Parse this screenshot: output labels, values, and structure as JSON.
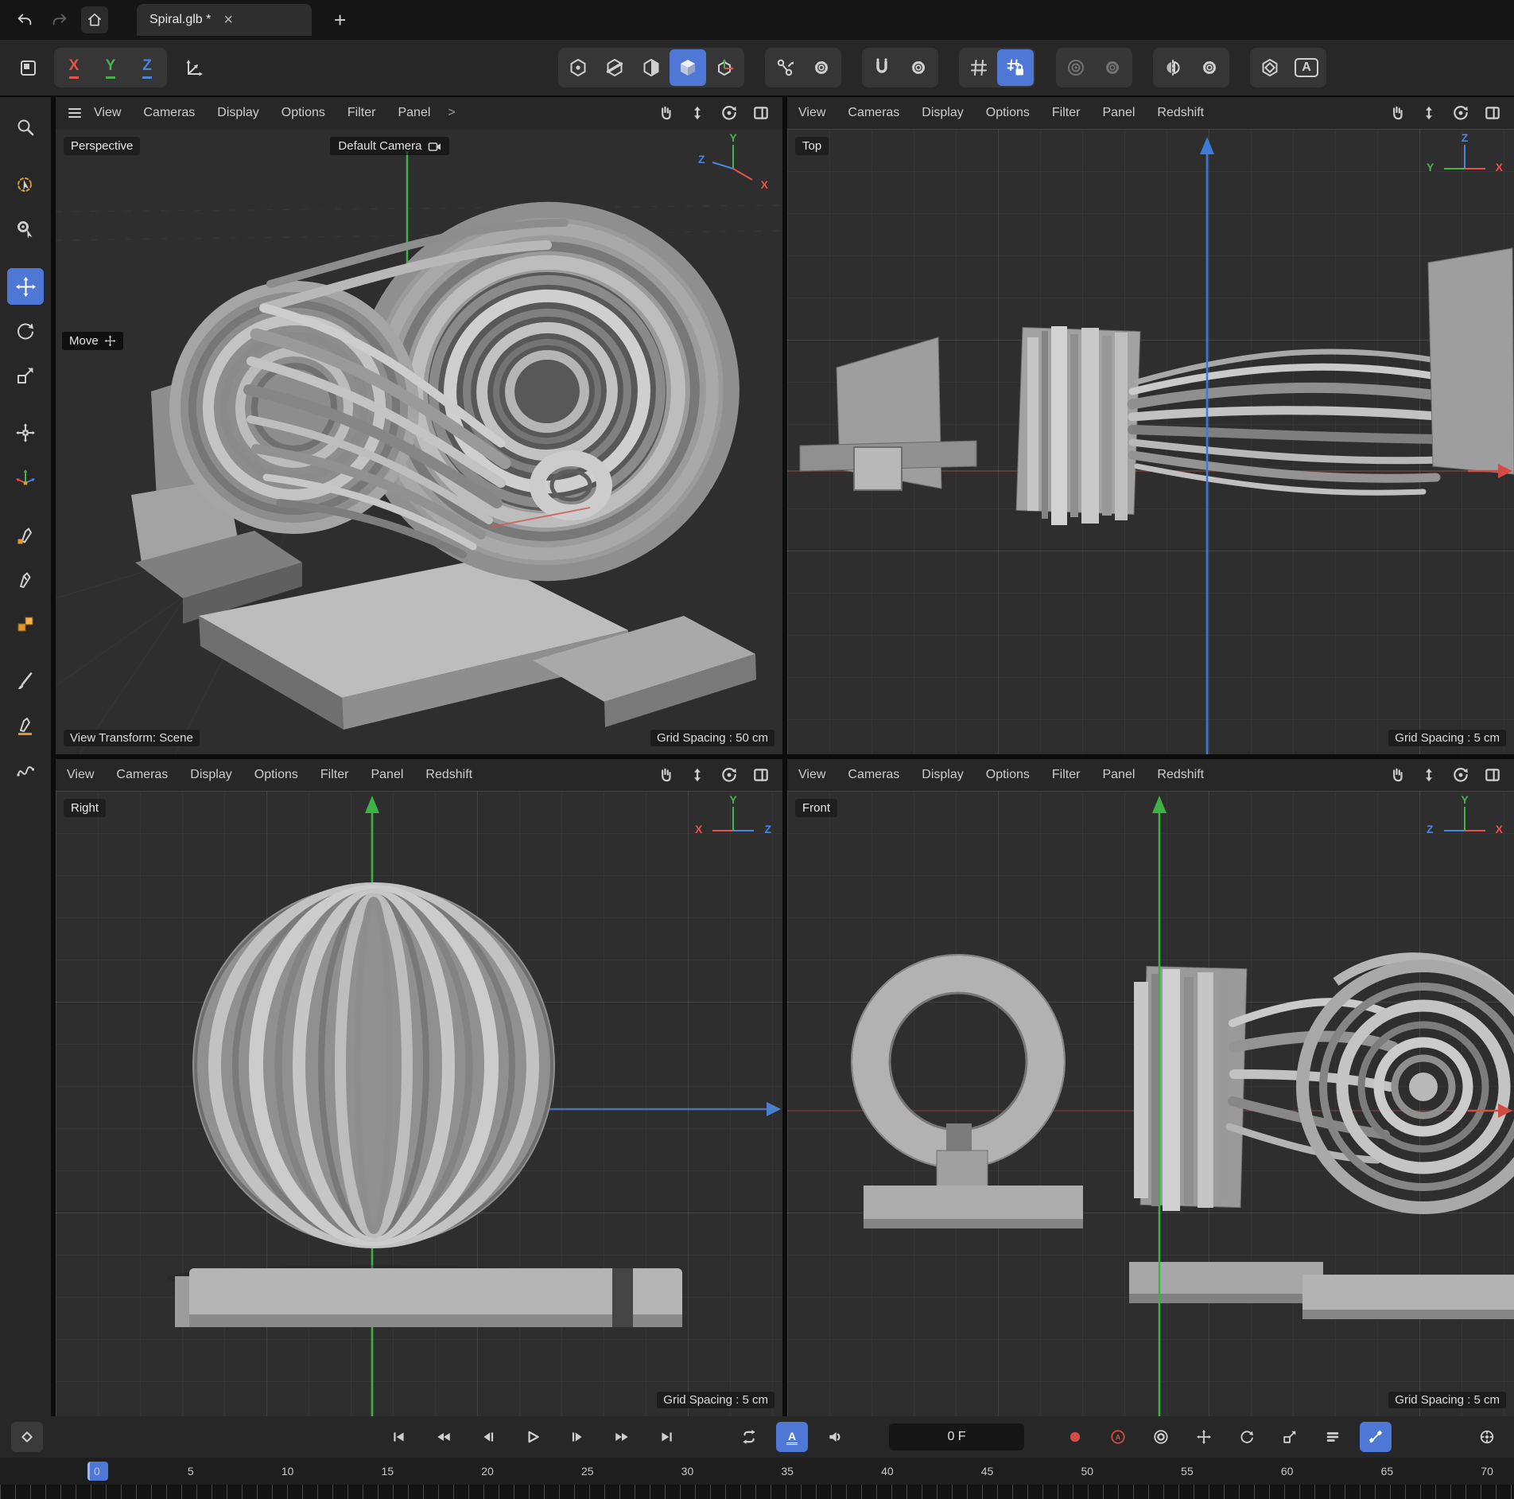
{
  "colors": {
    "accent": "#4e77d6",
    "axis_x": "#e5534b",
    "axis_y": "#46b44b",
    "axis_z": "#4a84e0",
    "object_gray": "#a8a8a8"
  },
  "tab_bar": {
    "title": "Spiral.glb *",
    "close_glyph": "×",
    "new_tab_glyph": "+"
  },
  "toolbar": {
    "axis_x": "X",
    "axis_y": "Y",
    "axis_z": "Z",
    "annotation_label": "A"
  },
  "viewports": {
    "perspective": {
      "label": "Perspective",
      "camera_pill": "Default Camera",
      "menus": [
        "View",
        "Cameras",
        "Display",
        "Options",
        "Filter",
        "Panel"
      ],
      "menu_overflow": ">",
      "tooltip_move": "Move",
      "status_left": "View Transform: Scene",
      "grid_label": "Grid Spacing : 50 cm",
      "gizmo": {
        "up": "Y",
        "left": "Z",
        "right": "X"
      }
    },
    "top": {
      "label": "Top",
      "menus": [
        "View",
        "Cameras",
        "Display",
        "Options",
        "Filter",
        "Panel",
        "Redshift"
      ],
      "grid_label": "Grid Spacing : 5 cm",
      "gizmo": {
        "up": "Z",
        "left": "Y",
        "right": "X"
      }
    },
    "right": {
      "label": "Right",
      "menus": [
        "View",
        "Cameras",
        "Display",
        "Options",
        "Filter",
        "Panel",
        "Redshift"
      ],
      "grid_label": "Grid Spacing : 5 cm",
      "gizmo": {
        "up": "Y",
        "left": "X",
        "right": "Z"
      }
    },
    "front": {
      "label": "Front",
      "menus": [
        "View",
        "Cameras",
        "Display",
        "Options",
        "Filter",
        "Panel",
        "Redshift"
      ],
      "grid_label": "Grid Spacing : 5 cm",
      "gizmo": {
        "up": "Y",
        "left": "Z",
        "right": "X"
      }
    }
  },
  "timeline": {
    "frame_field": "0 F",
    "autokey_label": "A",
    "animation_mode_label": "A",
    "ticks": [
      "0",
      "5",
      "10",
      "15",
      "20",
      "25",
      "30",
      "35",
      "40",
      "45",
      "50",
      "55",
      "60",
      "65",
      "70"
    ]
  }
}
